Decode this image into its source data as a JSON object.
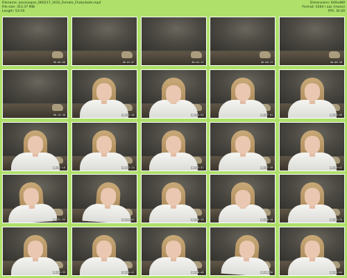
{
  "header": {
    "filename_label": "Filename:",
    "filename_value": "jessicooper_060217_1632_Female_Chaturbate.mp4",
    "filesize_label": "File size:",
    "filesize_value": "313.37 MiB",
    "length_label": "Length:",
    "length_value": "53:19",
    "dimensions_label": "Dimensions:",
    "dimensions_value": "640x480",
    "format_label": "Format:",
    "format_value": "h264 / aac (mono)",
    "fps_label": "FPS:",
    "fps_value": "30.00"
  },
  "thumbnails": [
    {
      "timestamp": "00:00:00",
      "person": false
    },
    {
      "timestamp": "00:02:07",
      "person": false
    },
    {
      "timestamp": "00:04:15",
      "person": false
    },
    {
      "timestamp": "00:06:23",
      "person": false
    },
    {
      "timestamp": "00:08:30",
      "person": false
    },
    {
      "timestamp": "00:10:38",
      "person": false
    },
    {
      "timestamp": "00:12:46",
      "person": true,
      "pose": "center"
    },
    {
      "timestamp": "00:14:53",
      "person": true,
      "pose": "down"
    },
    {
      "timestamp": "00:17:01",
      "person": true,
      "pose": "center"
    },
    {
      "timestamp": "00:19:09",
      "person": true,
      "pose": "center"
    },
    {
      "timestamp": "00:21:16",
      "person": true,
      "pose": "center"
    },
    {
      "timestamp": "00:23:24",
      "person": true,
      "pose": "center"
    },
    {
      "timestamp": "00:25:32",
      "person": true,
      "pose": "center"
    },
    {
      "timestamp": "00:27:39",
      "person": true,
      "pose": "center"
    },
    {
      "timestamp": "00:29:47",
      "person": true,
      "pose": "center"
    },
    {
      "timestamp": "00:31:55",
      "person": true,
      "pose": "lean-l"
    },
    {
      "timestamp": "00:34:02",
      "person": true,
      "pose": "lean-r"
    },
    {
      "timestamp": "00:36:10",
      "person": true,
      "pose": "center"
    },
    {
      "timestamp": "00:38:18",
      "person": true,
      "pose": "down"
    },
    {
      "timestamp": "00:40:25",
      "person": true,
      "pose": "center"
    },
    {
      "timestamp": "00:42:33",
      "person": true,
      "pose": "center"
    },
    {
      "timestamp": "00:44:41",
      "person": true,
      "pose": "center"
    },
    {
      "timestamp": "00:46:48",
      "person": true,
      "pose": "center"
    },
    {
      "timestamp": "00:48:56",
      "person": true,
      "pose": "lean-r"
    },
    {
      "timestamp": "00:51:04",
      "person": true,
      "pose": "center"
    }
  ],
  "colors": {
    "background": "#aee06a",
    "thumb_border": "#ffffff"
  }
}
